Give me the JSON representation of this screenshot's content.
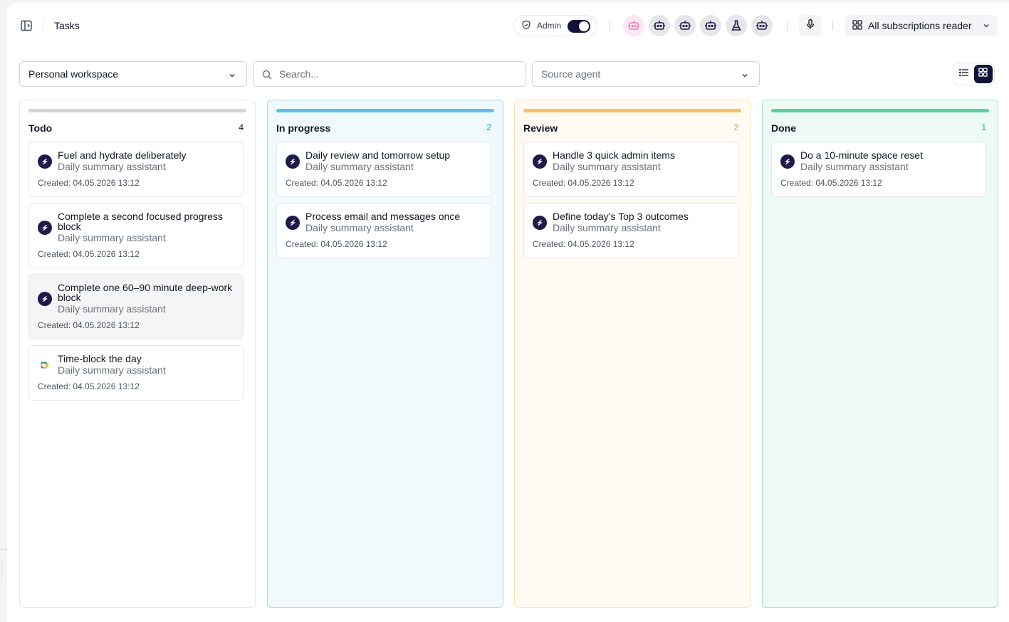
{
  "header": {
    "title": "Tasks",
    "admin_label": "Admin",
    "admin_enabled": true,
    "agents": [
      "robot-pink-icon",
      "robot-icon",
      "robot-icon",
      "robot-icon",
      "flask-icon",
      "robot-icon"
    ],
    "subscription_label": "All subscriptions reader"
  },
  "toolbar": {
    "workspace": "Personal workspace",
    "search_placeholder": "Search...",
    "source_agent_placeholder": "Source agent",
    "view_mode": "board"
  },
  "columns": [
    {
      "title": "Todo",
      "count": "4",
      "bar_color": "#d1d5db",
      "count_color": "#111827",
      "bg": "#ffffff",
      "border": "#e5e7eb",
      "cards": [
        {
          "title": "Fuel and hydrate deliberately",
          "subtitle": "Daily summary assistant",
          "created": "Created: 04.05.2026 13:12",
          "icon": "s-logo-icon"
        },
        {
          "title": "Complete a second focused progress block",
          "subtitle": "Daily summary assistant",
          "created": "Created: 04.05.2026 13:12",
          "icon": "s-logo-icon"
        },
        {
          "title": "Complete one 60–90 minute deep-work block",
          "subtitle": "Daily summary assistant",
          "created": "Created: 04.05.2026 13:12",
          "icon": "s-logo-icon"
        },
        {
          "title": "Time-block the day",
          "subtitle": "Daily summary assistant",
          "created": "Created: 04.05.2026 13:12",
          "icon": "calendar-icon"
        }
      ]
    },
    {
      "title": "In progress",
      "count": "2",
      "bar_color": "#60bfeb",
      "count_color": "#0ea5e9",
      "bg": "#f0f9fc",
      "border": "#a5dcf3",
      "cards": [
        {
          "title": "Daily review and tomorrow setup",
          "subtitle": "Daily summary assistant",
          "created": "Created: 04.05.2026 13:12",
          "icon": "s-logo-icon"
        },
        {
          "title": "Process email and messages once",
          "subtitle": "Daily summary assistant",
          "created": "Created: 04.05.2026 13:12",
          "icon": "s-logo-icon"
        }
      ]
    },
    {
      "title": "Review",
      "count": "2",
      "bar_color": "#fbbf68",
      "count_color": "#f59e0b",
      "bg": "#fffaf2",
      "border": "#fbe2bd",
      "cards": [
        {
          "title": "Handle 3 quick admin items",
          "subtitle": "Daily summary assistant",
          "created": "Created: 04.05.2026 13:12",
          "icon": "s-logo-icon"
        },
        {
          "title": "Define today’s Top 3 outcomes",
          "subtitle": "Daily summary assistant",
          "created": "Created: 04.05.2026 13:12",
          "icon": "s-logo-icon"
        }
      ]
    },
    {
      "title": "Done",
      "count": "1",
      "bar_color": "#5ccf9f",
      "count_color": "#10b981",
      "bg": "#eefaf5",
      "border": "#a6e3c9",
      "cards": [
        {
          "title": "Do a 10-minute space reset",
          "subtitle": "Daily summary assistant",
          "created": "Created: 04.05.2026 13:12",
          "icon": "s-logo-icon"
        }
      ]
    }
  ]
}
